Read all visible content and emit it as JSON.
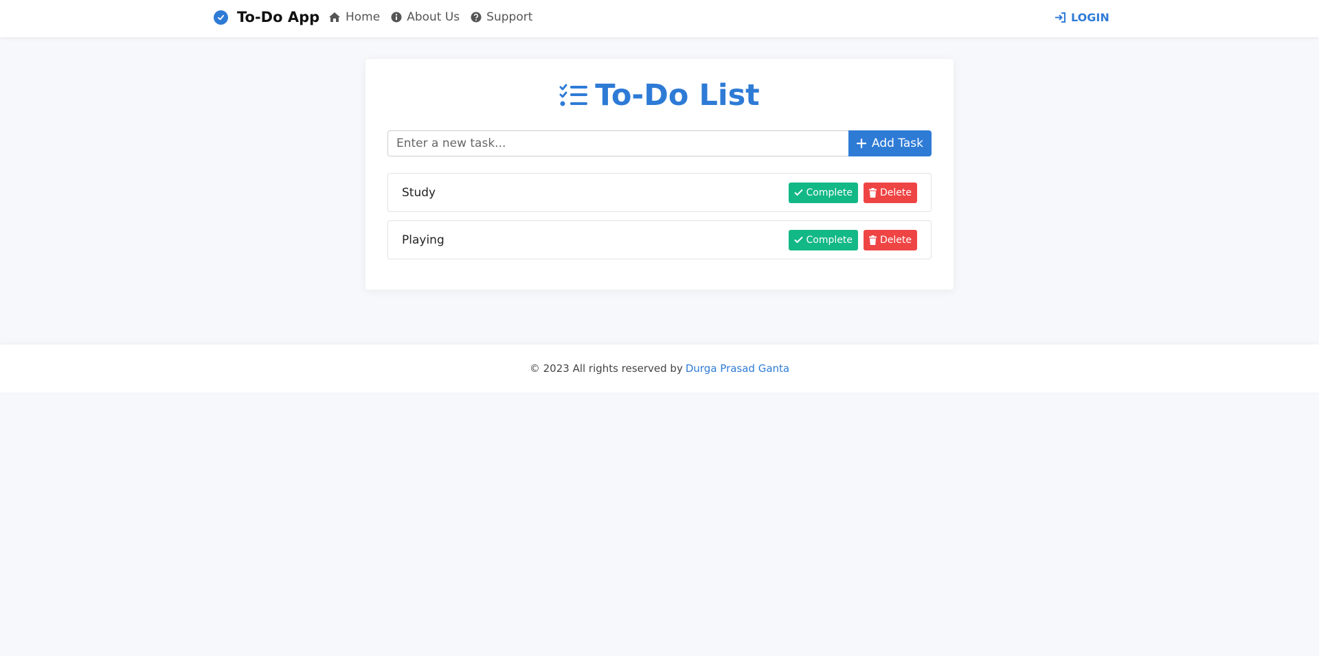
{
  "navbar": {
    "brand": "To-Do App",
    "brand_icon": "check-circle-icon",
    "links": [
      {
        "label": "Home",
        "icon": "home-icon"
      },
      {
        "label": "About Us",
        "icon": "info-circle-icon"
      },
      {
        "label": "Support",
        "icon": "question-circle-icon"
      }
    ],
    "login_label": "LOGIN",
    "login_icon": "sign-in-icon"
  },
  "main": {
    "title": "To-Do List",
    "title_icon": "list-check-icon",
    "input_placeholder": "Enter a new task...",
    "input_value": "",
    "add_button_label": "Add Task",
    "tasks": [
      {
        "text": "Study",
        "complete_label": "Complete",
        "delete_label": "Delete"
      },
      {
        "text": "Playing",
        "complete_label": "Complete",
        "delete_label": "Delete"
      }
    ]
  },
  "footer": {
    "text": "© 2023 All rights reserved by",
    "author": "Durga Prasad Ganta"
  },
  "colors": {
    "primary": "#2e7bd6",
    "complete": "#12b886",
    "delete": "#ef4444",
    "background": "#f7f8fb"
  }
}
